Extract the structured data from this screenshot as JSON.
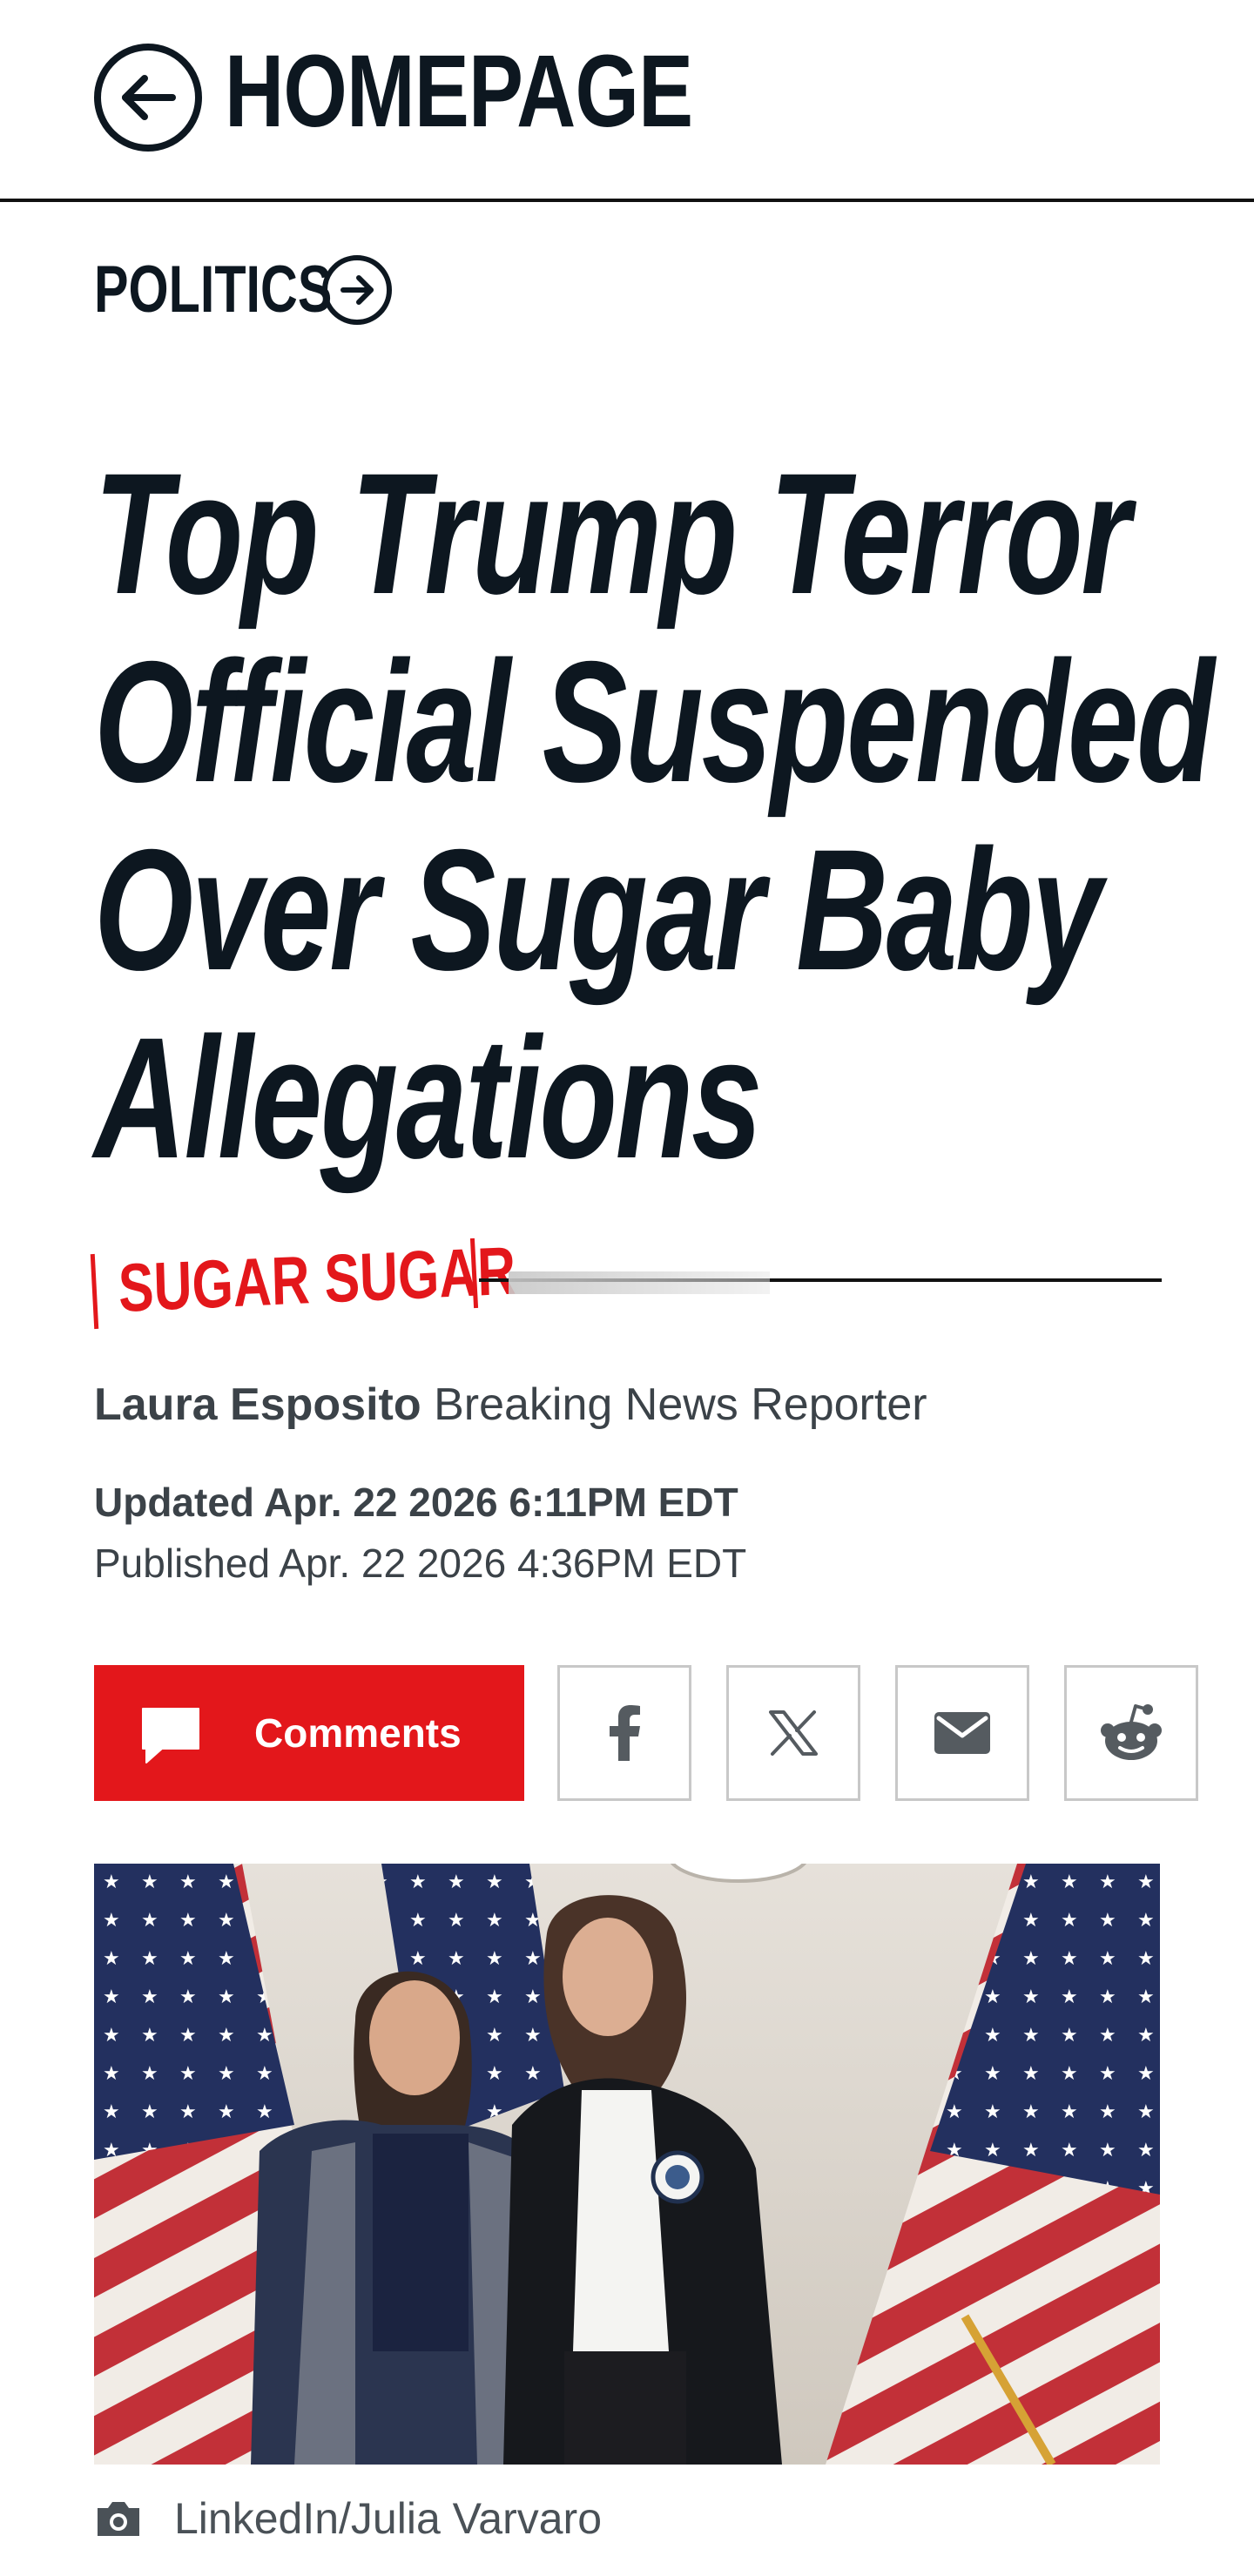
{
  "nav": {
    "back_label": "HOMEPAGE"
  },
  "section": {
    "label": "POLITICS"
  },
  "article": {
    "headline_lines": [
      "Top Trump Terror",
      "Official Suspended",
      "Over Sugar Baby",
      "Allegations"
    ],
    "rubric": "SUGAR SUGAR",
    "author": "Laura Esposito",
    "author_role": "Breaking News Reporter",
    "updated": "Updated Apr. 22 2026 6:11PM EDT",
    "published": "Published Apr. 22 2026 4:36PM EDT",
    "photo_credit": "LinkedIn/Julia Varvaro"
  },
  "share": {
    "comments_label": "Comments",
    "buttons": [
      "facebook-icon",
      "x-icon",
      "email-icon",
      "reddit-icon"
    ]
  },
  "colors": {
    "brand_red": "#e3171b",
    "ink": "#0d1720",
    "meta_gray": "#3b4248",
    "border_gray": "#c8c8c8"
  }
}
